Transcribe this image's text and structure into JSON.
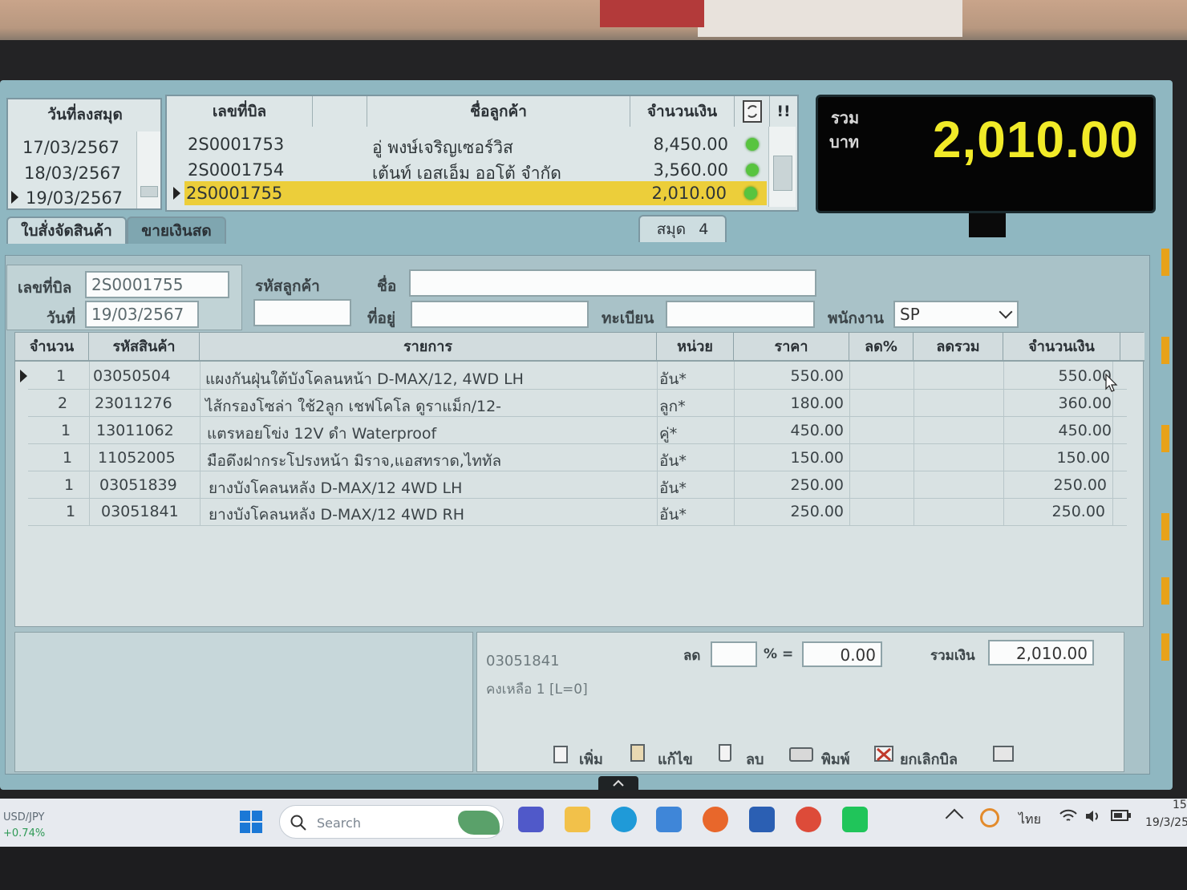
{
  "dates_panel": {
    "header": "วันที่ลงสมุด",
    "rows": [
      "17/03/2567",
      "18/03/2567",
      "19/03/2567"
    ]
  },
  "bills_panel": {
    "headers": [
      "เลขที่บิล",
      "ชื่อลูกค้า",
      "จำนวนเงิน",
      "!!"
    ],
    "rows": [
      {
        "bill": "2S0001753",
        "customer": "อู่ พงษ์เจริญเซอร์วิส",
        "amount": "8,450.00"
      },
      {
        "bill": "2S0001754",
        "customer": "เต้นท์ เอสเอ็ม ออโต้ จำกัด",
        "amount": "3,560.00"
      },
      {
        "bill": "2S0001755",
        "customer": "",
        "amount": "2,010.00"
      }
    ]
  },
  "total": {
    "label_line1": "รวม",
    "label_line2": "บาท",
    "value": "2,010.00"
  },
  "tabs": {
    "delivery": "ใบสั่งจัดสินค้า",
    "cash_sale": "ขายเงินสด",
    "book_label": "สมุด",
    "book_number": "4"
  },
  "form": {
    "bill_no_label": "เลขที่บิล",
    "bill_no": "2S0001755",
    "date_label": "วันที่",
    "date": "19/03/2567",
    "customer_code_label": "รหัสลูกค้า",
    "customer_code": "",
    "name_label": "ชื่อ",
    "name": "",
    "address_label": "ที่อยู่",
    "address": "",
    "registration_label": "ทะเบียน",
    "registration": "",
    "employee_label": "พนักงาน",
    "employee": "SP"
  },
  "items": {
    "headers": [
      "จำนวน",
      "รหัสสินค้า",
      "รายการ",
      "หน่วย",
      "ราคา",
      "ลด%",
      "ลดรวม",
      "จำนวนเงิน"
    ],
    "rows": [
      {
        "qty": "1",
        "code": "03050504",
        "desc": "แผงกันฝุ่นใต้บังโคลนหน้า D-MAX/12, 4WD LH",
        "unit": "อัน*",
        "price": "550.00",
        "disc_pct": "",
        "disc_total": "",
        "amount": "550.00"
      },
      {
        "qty": "2",
        "code": "23011276",
        "desc": "ไส้กรองโซล่า ใช้2ลูก เชฟโคโล ดูราแม็ก/12-",
        "unit": "ลูก*",
        "price": "180.00",
        "disc_pct": "",
        "disc_total": "",
        "amount": "360.00"
      },
      {
        "qty": "1",
        "code": "13011062",
        "desc": "แตรหอยโข่ง 12V ดำ Waterproof",
        "unit": "คู่*",
        "price": "450.00",
        "disc_pct": "",
        "disc_total": "",
        "amount": "450.00"
      },
      {
        "qty": "1",
        "code": "11052005",
        "desc": "มือดึงฝากระโปรงหน้า มิราจ,แอสทราด,ไททัล",
        "unit": "อัน*",
        "price": "150.00",
        "disc_pct": "",
        "disc_total": "",
        "amount": "150.00"
      },
      {
        "qty": "1",
        "code": "03051839",
        "desc": "ยางบังโคลนหลัง D-MAX/12 4WD LH",
        "unit": "อัน*",
        "price": "250.00",
        "disc_pct": "",
        "disc_total": "",
        "amount": "250.00"
      },
      {
        "qty": "1",
        "code": "03051841",
        "desc": "ยางบังโคลนหลัง D-MAX/12 4WD RH",
        "unit": "อัน*",
        "price": "250.00",
        "disc_pct": "",
        "disc_total": "",
        "amount": "250.00"
      }
    ]
  },
  "footer": {
    "selected_code": "03051841",
    "remaining": "คงเหลือ 1 [L=0]",
    "discount_label": "ลด",
    "discount_pct": "",
    "pct_equals": "% =",
    "discount_value": "0.00",
    "sum_label": "รวมเงิน",
    "sum_value": "2,010.00"
  },
  "toolbar": {
    "add": "เพิ่ม",
    "edit": "แก้ไข",
    "delete": "ลบ",
    "print": "พิมพ์",
    "cancel_bill": "ยกเลิกบิล"
  },
  "taskbar": {
    "ticker_name": "USD/JPY",
    "ticker_change": "+0.74%",
    "search_placeholder": "Search",
    "language": "ไทย",
    "time": "15",
    "date": "19/3/25"
  },
  "colors": {
    "selection": "#ecce3a",
    "total_text": "#f1ea28",
    "status_dot": "#58c43f",
    "screen_bg": "#8fb7c1"
  }
}
